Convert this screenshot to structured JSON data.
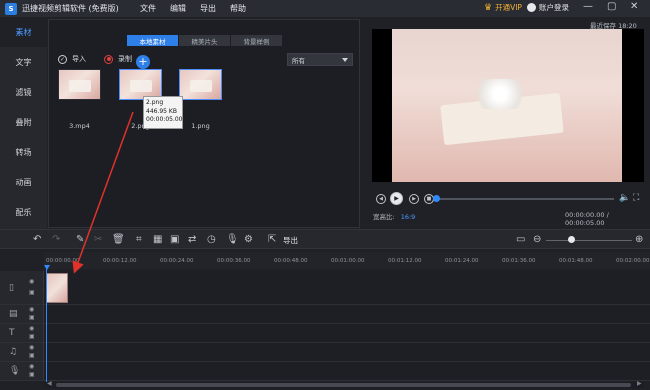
{
  "window": {
    "title": "迅捷视频剪辑软件 (免费版)",
    "logo_text": "S",
    "menu": [
      "文件",
      "编辑",
      "导出",
      "帮助"
    ],
    "vip_label": "开通VIP",
    "login_label": "账户登录",
    "controls": [
      "—",
      "▢",
      "✕"
    ]
  },
  "sidebar": {
    "items": [
      {
        "label": "素材",
        "active": true
      },
      {
        "label": "文字",
        "active": false
      },
      {
        "label": "滤镜",
        "active": false
      },
      {
        "label": "叠附",
        "active": false
      },
      {
        "label": "转场",
        "active": false
      },
      {
        "label": "动画",
        "active": false
      },
      {
        "label": "配乐",
        "active": false
      }
    ]
  },
  "media": {
    "tabs": [
      {
        "label": "本地素材",
        "active": true
      },
      {
        "label": "精美片头",
        "active": false
      },
      {
        "label": "背景样例",
        "active": false
      }
    ],
    "import_label": "导入",
    "record_label": "录制",
    "filter_value": "所有",
    "items": [
      {
        "label": "3.mp4"
      },
      {
        "label": "2.png"
      },
      {
        "label": "1.png"
      }
    ],
    "tooltip": {
      "name": "2.png",
      "size": "446.95 KB",
      "duration": "00:00:05.00"
    }
  },
  "preview": {
    "autosave": "最近保存 18:20",
    "aspect_label": "宽高比:",
    "aspect_value": "16:9",
    "timecode": "00:00:00.00 / 00:00:05.00",
    "progress": 0.0
  },
  "toolbar": {
    "export_label": "导出"
  },
  "ruler": {
    "ticks": [
      "00:00:00.00",
      "00:00:12.00",
      "00:00:24.00",
      "00:00:36.00",
      "00:00:48.00",
      "00:01:00.00",
      "00:01:12.00",
      "00:01:24.00",
      "00:01:36.00",
      "00:01:48.00",
      "00:02:00.00"
    ]
  },
  "colors": {
    "accent": "#2f8bff",
    "vip": "#f3b236",
    "record": "#e0413c",
    "arrow": "#e0312b"
  }
}
